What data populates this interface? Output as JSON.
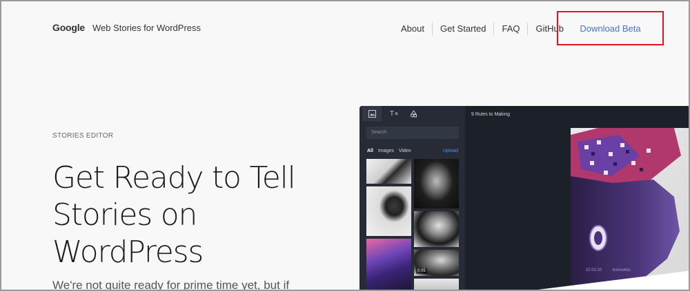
{
  "header": {
    "logo": "Google",
    "title": "Web Stories for WordPress",
    "nav": [
      "About",
      "Get Started",
      "FAQ",
      "GitHub"
    ],
    "download_label": "Download Beta"
  },
  "hero": {
    "eyebrow": "STORIES EDITOR",
    "headline_lines": [
      "Get Ready to Tell",
      "Stories on",
      "WordPress"
    ],
    "subline": "We're not quite ready for prime time yet, but if"
  },
  "editor": {
    "search_placeholder": "Search",
    "filters": [
      "All",
      "Images",
      "Video"
    ],
    "upload_label": "Upload",
    "canvas_title": "9 Rules to Making",
    "video_duration": "0:05",
    "canvas_time": "02:02:20",
    "canvas_credit": "bxkxwkkx"
  },
  "colors": {
    "accent_link": "#4a73c9",
    "highlight_box": "#e0141a",
    "editor_bg": "#1c2028",
    "sidebar_bg": "#262b36",
    "upload_blue": "#4d8dff"
  },
  "icons": {
    "tab_media": "image-icon",
    "tab_text": "text-icon",
    "tab_shapes": "shapes-icon"
  }
}
